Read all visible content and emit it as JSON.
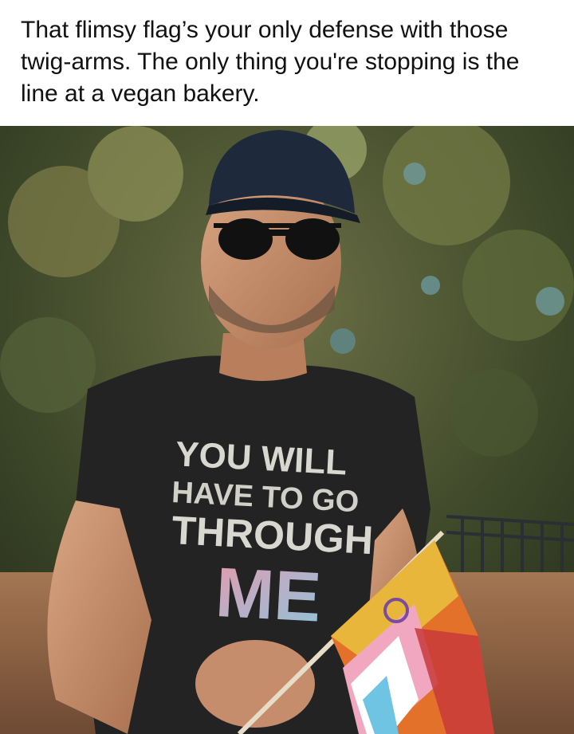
{
  "post": {
    "caption": "That flimsy flag’s your only defense with those twig-arms. The only thing you're stopping is the line at a vegan bakery."
  },
  "photo": {
    "subject": "man in cap, sunglasses and black t-shirt holding a progress pride flag",
    "shirt_text": {
      "line1": "YOU WILL",
      "line2": "HAVE TO GO",
      "line3": "THROUGH",
      "line4": "ME"
    },
    "colors": {
      "foliage_dark": "#2f3a22",
      "foliage_light": "#8b8f56",
      "sky_tint": "#6fa0a8",
      "shirt": "#232323",
      "skin": "#c58d6c",
      "cap": "#1e2a3c",
      "flag_orange": "#e3712a",
      "flag_yellow": "#e8b63a",
      "flag_pink": "#f2a7c0",
      "flag_blue": "#6fc3e3",
      "me_pink": "#e89aa9",
      "me_blue": "#8ec4d6"
    }
  }
}
